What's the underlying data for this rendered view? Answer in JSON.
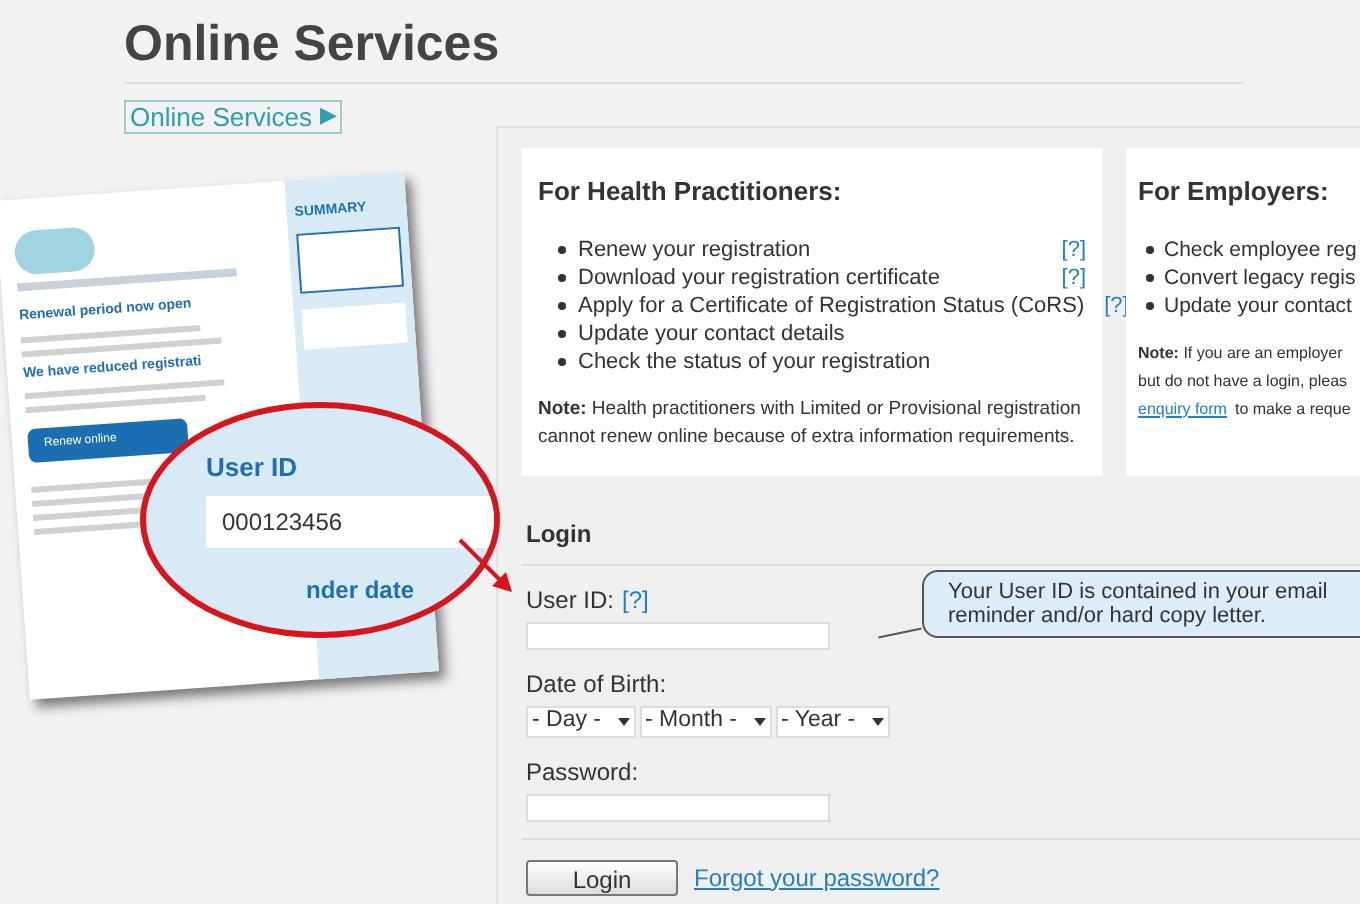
{
  "page_title": "Online Services",
  "breadcrumb": {
    "label": "Online Services",
    "arrow": "▶"
  },
  "letter": {
    "summary": "SUMMARY",
    "heading": "Renewal period now open",
    "subheading": "We have reduced registrati",
    "button": "Renew online",
    "magnifier": {
      "label": "User ID",
      "value": "000123456",
      "below": "nder date"
    }
  },
  "practitioners": {
    "title": "For Health Practitioners:",
    "items": [
      {
        "text": "Renew your registration",
        "help": "[?]"
      },
      {
        "text": "Download your registration certificate",
        "help": "[?]"
      },
      {
        "text": "Apply for a Certificate of Registration Status (CoRS)",
        "help": "[?]"
      },
      {
        "text": "Update your contact details"
      },
      {
        "text": "Check the status of your registration"
      }
    ],
    "note_label": "Note:",
    "note": "Health practitioners with Limited or Provisional registration cannot renew online because of extra information requirements."
  },
  "employers": {
    "title": "For Employers:",
    "items": [
      "Check employee reg",
      "Convert legacy regis",
      "Update your contact"
    ],
    "note_label": "Note:",
    "note_lines": [
      "If you are an employer",
      "but do not have a login, pleas"
    ],
    "note_link": "enquiry form",
    "note_tail": "to make a reque"
  },
  "login": {
    "title": "Login",
    "user_id_label": "User ID:",
    "user_id_help": "[?]",
    "tooltip": "Your User ID is contained in your email reminder and/or hard copy letter.",
    "dob_label": "Date of Birth:",
    "dob_selects": [
      "- Day -",
      "- Month -",
      "- Year -"
    ],
    "password_label": "Password:",
    "button": "Login",
    "forgot": "Forgot your password?"
  }
}
